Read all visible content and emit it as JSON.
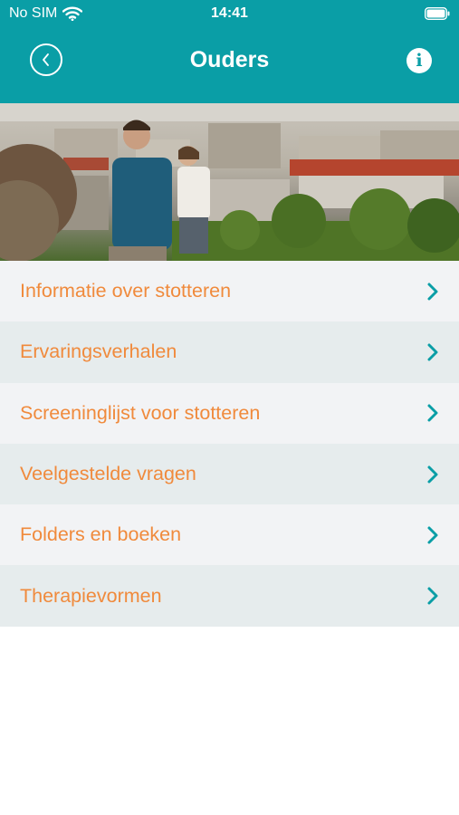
{
  "status": {
    "carrier": "No SIM",
    "time": "14:41"
  },
  "header": {
    "title": "Ouders"
  },
  "icons": {
    "wifi": "wifi-icon",
    "battery": "battery-icon",
    "back": "chevron-left-icon",
    "info": "info-icon",
    "chevron": "chevron-right-icon"
  },
  "colors": {
    "header_bg": "#0A9EA6",
    "label": "#F08A3C",
    "row_light": "#F2F3F5",
    "row_dark": "#E6ECED"
  },
  "menu": {
    "items": [
      {
        "label": "Informatie over stotteren"
      },
      {
        "label": "Ervaringsverhalen"
      },
      {
        "label": "Screeninglijst voor stotteren"
      },
      {
        "label": "Veelgestelde vragen"
      },
      {
        "label": "Folders en boeken"
      },
      {
        "label": "Therapievormen"
      }
    ]
  }
}
